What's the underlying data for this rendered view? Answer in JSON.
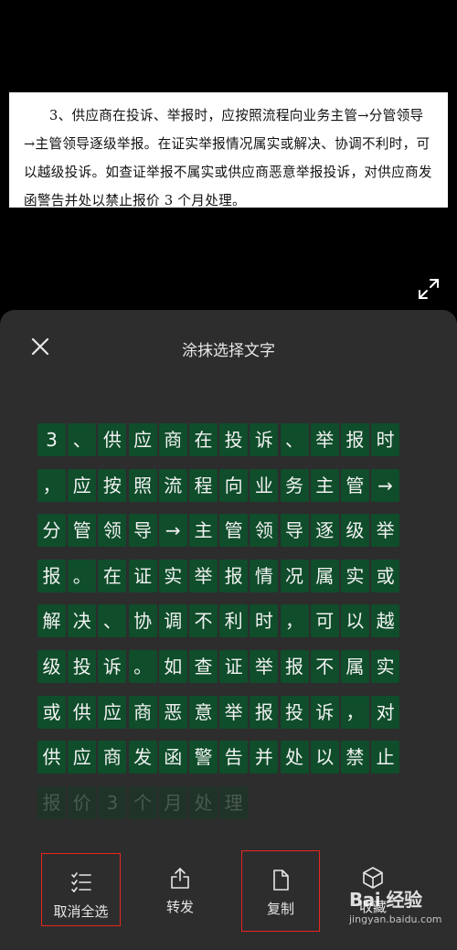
{
  "document": {
    "lines": [
      "3、供应商在投诉、举报时，应按照流程向业务主管→分管领导",
      "→主管领导逐级举报。在证实举报情况属实或解决、协调不利时，可",
      "以越级投诉。如查证举报不属实或供应商恶意举报投诉，对供应商发",
      "函警告并处以禁止报价 3 个月处理。"
    ]
  },
  "panel": {
    "title": "涂抹选择文字",
    "rows": [
      [
        "3",
        "、",
        "供",
        "应",
        "商",
        "在",
        "投",
        "诉",
        "、",
        "举",
        "报",
        "时"
      ],
      [
        "，",
        "应",
        "按",
        "照",
        "流",
        "程",
        "向",
        "业",
        "务",
        "主",
        "管",
        "→"
      ],
      [
        "分",
        "管",
        "领",
        "导",
        "→",
        "主",
        "管",
        "领",
        "导",
        "逐",
        "级",
        "举"
      ],
      [
        "报",
        "。",
        "在",
        "证",
        "实",
        "举",
        "报",
        "情",
        "况",
        "属",
        "实",
        "或"
      ],
      [
        "解",
        "决",
        "、",
        "协",
        "调",
        "不",
        "利",
        "时",
        "，",
        "可",
        "以",
        "越"
      ],
      [
        "级",
        "投",
        "诉",
        "。",
        "如",
        "查",
        "证",
        "举",
        "报",
        "不",
        "属",
        "实"
      ],
      [
        "或",
        "供",
        "应",
        "商",
        "恶",
        "意",
        "举",
        "报",
        "投",
        "诉",
        "，",
        "对"
      ],
      [
        "供",
        "应",
        "商",
        "发",
        "函",
        "警",
        "告",
        "并",
        "处",
        "以",
        "禁",
        "止"
      ],
      [
        "报",
        "价",
        "3",
        "个",
        "月",
        "处",
        "理"
      ]
    ]
  },
  "toolbar": {
    "deselect_all": "取消全选",
    "forward": "转发",
    "copy": "复制",
    "favorite": "收藏"
  },
  "watermark": {
    "brand": "Bai 经验",
    "url": "jingyan.baidu.com"
  },
  "colors": {
    "selected_char_bg": "#0f4d2b",
    "highlight_border": "#e8261f",
    "panel_bg": "#2d2d2d"
  }
}
